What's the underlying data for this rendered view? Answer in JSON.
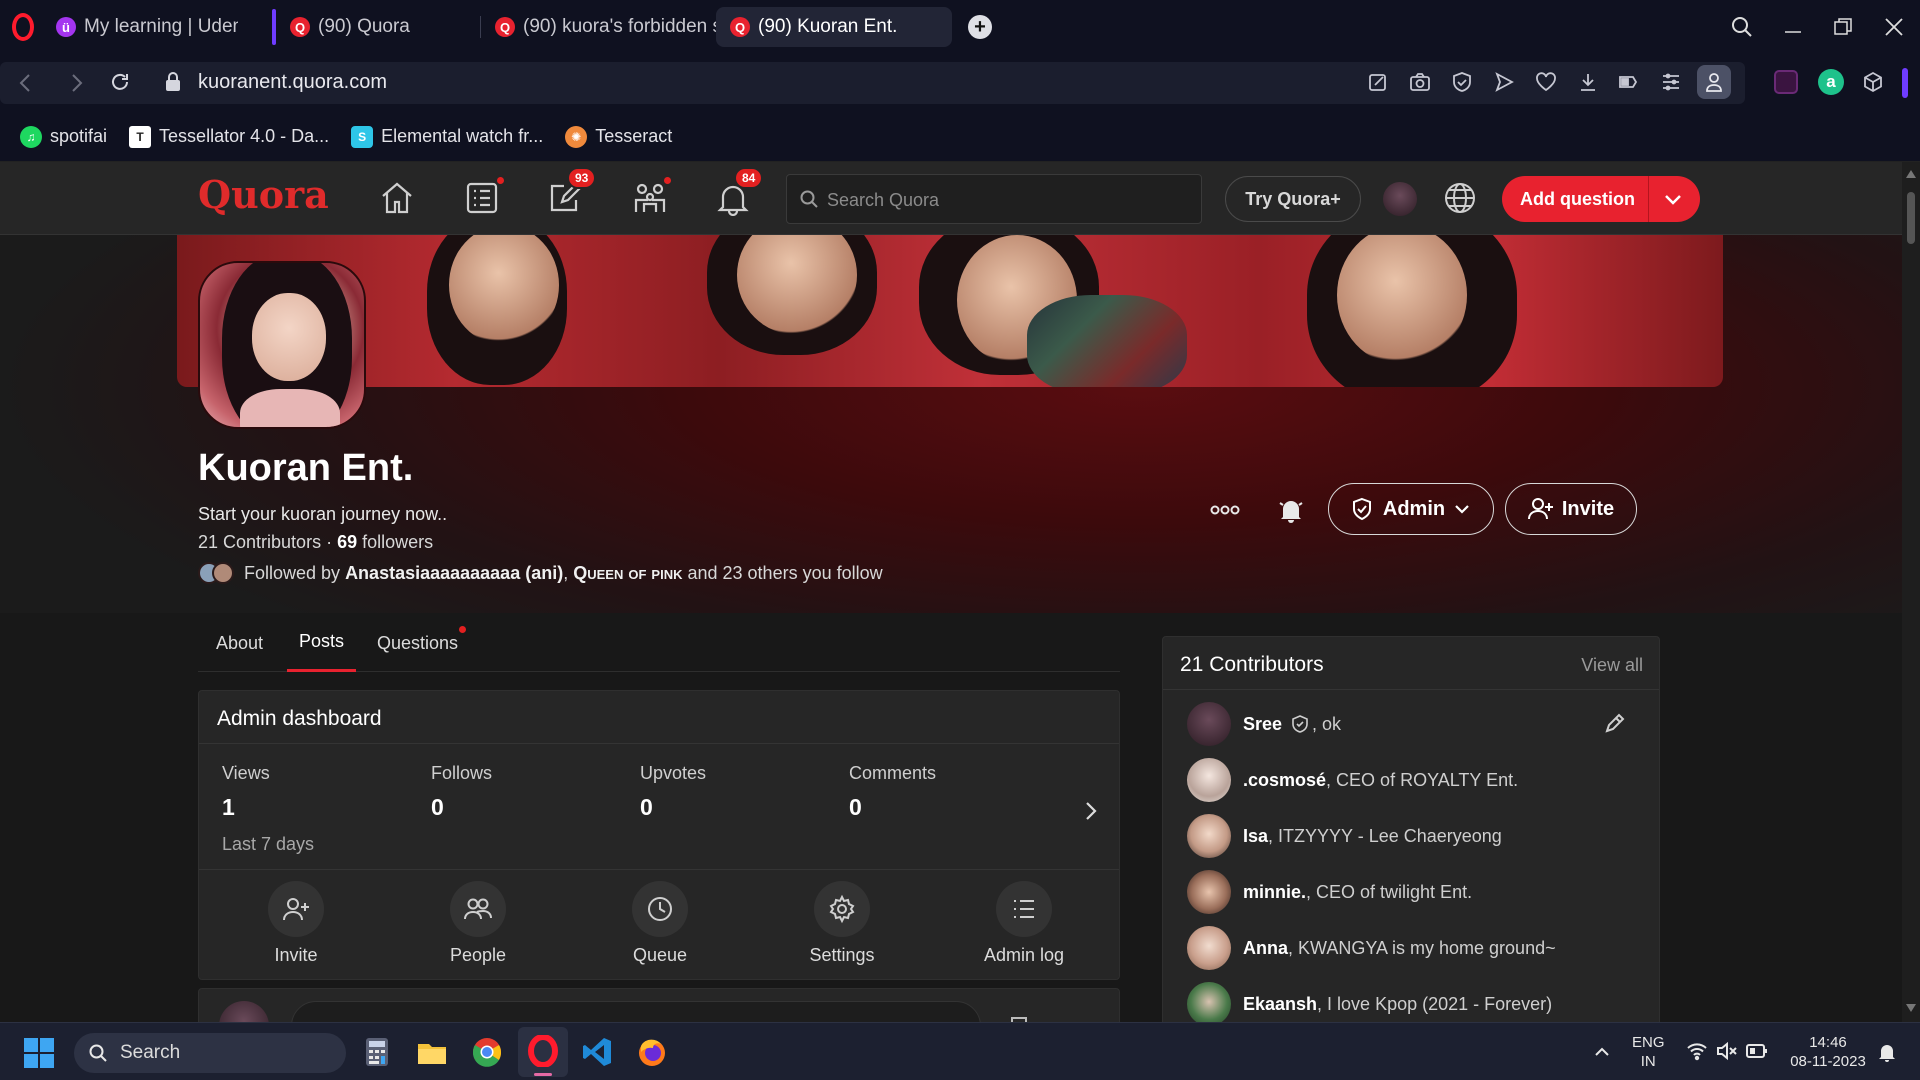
{
  "browser": {
    "tabs": [
      {
        "label": "My learning | Udemy",
        "icon": "udemy-icon",
        "color": "#a435f0"
      },
      {
        "label": "(90) Quora",
        "icon": "quora-icon",
        "color": "#e8222f"
      },
      {
        "label": "(90) kuora's forbidden s",
        "icon": "quora-icon",
        "color": "#e8222f"
      },
      {
        "label": "(90) Kuoran Ent.",
        "icon": "quora-icon",
        "color": "#e8222f"
      }
    ],
    "url": "kuoranent.quora.com",
    "bookmarks": [
      {
        "label": "spotifai",
        "icon": "spotify-icon",
        "color": "#1ed760"
      },
      {
        "label": "Tessellator 4.0 - Da...",
        "icon": "tessellator-icon",
        "color": "#ffffff"
      },
      {
        "label": "Elemental watch fr...",
        "icon": "elemental-icon",
        "color": "#2ec6e8"
      },
      {
        "label": "Tesseract",
        "icon": "tesseract-icon",
        "color": "#f08a3c"
      }
    ]
  },
  "quora": {
    "logo": "Quora",
    "search_placeholder": "Search Quora",
    "try_plus": "Try Quora+",
    "add_question": "Add question",
    "badges": {
      "answer": "93",
      "notifications": "84"
    },
    "accent": "#e8222f"
  },
  "profile": {
    "name": "Kuoran Ent.",
    "tagline": "Start your kuoran journey now..",
    "contributors_text": "21 Contributors · ",
    "followers_count": "69",
    "followers_label": " followers",
    "followed_by_prefix": "Followed by ",
    "follower_1": "Anastasiaaaaaaaaaa (ani)",
    "follower_sep": ", ",
    "follower_2": "Queen of pink",
    "followed_by_suffix": " and 23 others you follow",
    "admin_button": "Admin",
    "invite_button": "Invite"
  },
  "tabs": [
    "About",
    "Posts",
    "Questions"
  ],
  "dashboard": {
    "title": "Admin dashboard",
    "stats": [
      {
        "label": "Views",
        "value": "1"
      },
      {
        "label": "Follows",
        "value": "0"
      },
      {
        "label": "Upvotes",
        "value": "0"
      },
      {
        "label": "Comments",
        "value": "0"
      }
    ],
    "range": "Last 7 days",
    "actions": [
      {
        "label": "Invite",
        "icon": "add-person-icon"
      },
      {
        "label": "People",
        "icon": "people-icon"
      },
      {
        "label": "Queue",
        "icon": "clock-icon"
      },
      {
        "label": "Settings",
        "icon": "gear-icon"
      },
      {
        "label": "Admin log",
        "icon": "list-icon"
      }
    ]
  },
  "contributors": {
    "title": "21 Contributors",
    "view_all": "View all",
    "items": [
      {
        "name": "Sree",
        "desc": ", ok"
      },
      {
        "name": ".cosmosé",
        "desc": ", CEO of ROYALTY Ent."
      },
      {
        "name": "Isa",
        "desc": ", ITZYYYY - Lee Chaeryeong"
      },
      {
        "name": "minnie.",
        "desc": ", CEO of twilight Ent."
      },
      {
        "name": "Anna",
        "desc": ", KWANGYA is my home ground~"
      },
      {
        "name": "Ekaansh",
        "desc": ", I love Kpop (2021 - Forever)"
      }
    ]
  },
  "taskbar": {
    "search": "Search",
    "lang1": "ENG",
    "lang2": "IN",
    "time": "14:46",
    "date": "08-11-2023"
  }
}
